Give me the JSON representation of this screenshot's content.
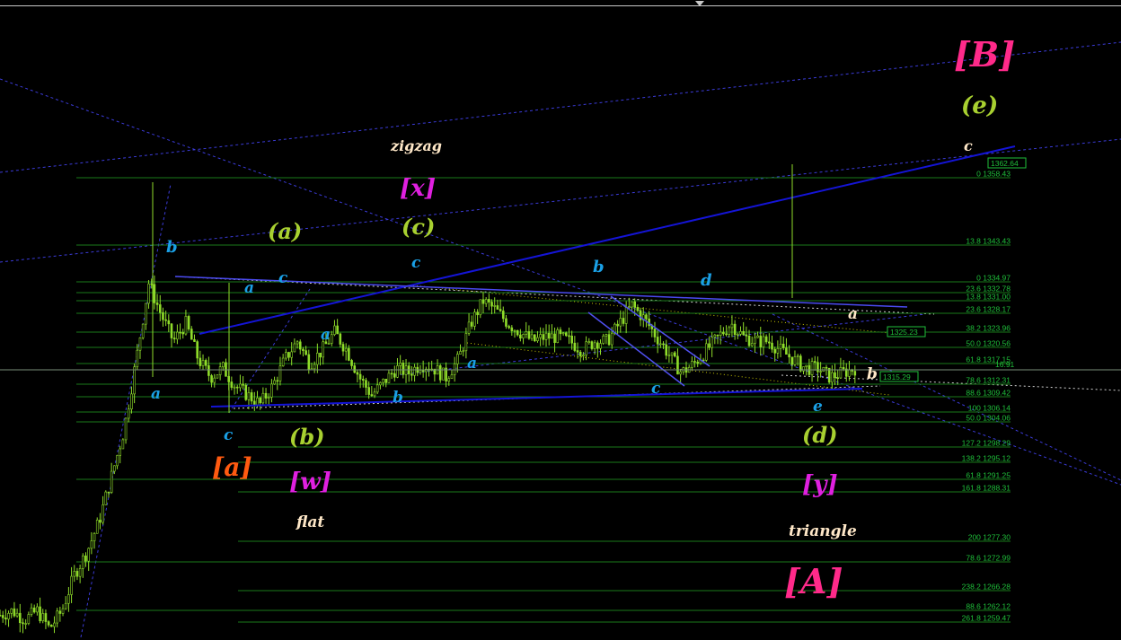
{
  "colors": {
    "background": "#000000",
    "fib_line": "#1a7a1a",
    "fib_text": "#1fbf3a",
    "candle": "#8fdc2a",
    "trend_blue": "#1414d6",
    "dash_blue": "#3b3bd8",
    "dash_white": "#d0d0d0",
    "dash_yellow": "#c8c800",
    "label_cyan": "#1aa0e6",
    "label_olive": "#a8d030",
    "label_magenta": "#e020e0",
    "label_pink": "#ff2a8a",
    "label_orange": "#ff5a10",
    "label_cream": "#ffe8c8",
    "price_box": "#1fbf3a"
  },
  "price_labels": {
    "box_upper": "1362.64",
    "box_mid": "1325.23",
    "box_current": "1315.29",
    "current_right": "16.91"
  },
  "fib_levels": [
    {
      "text": "0 1358.43"
    },
    {
      "text": "13.8 1343.43"
    },
    {
      "text": "0 1334.97"
    },
    {
      "text": "23.6 1332.78"
    },
    {
      "text": "13.8 1331.00"
    },
    {
      "text": "23.6 1328.17"
    },
    {
      "text": "38.2 1323.96"
    },
    {
      "text": "50.0 1320.56"
    },
    {
      "text": "61.8 1317.15"
    },
    {
      "text": "78.6 1312.31"
    },
    {
      "text": "88.6 1309.42"
    },
    {
      "text": "100 1306.14"
    },
    {
      "text": "50.0 1304.06"
    },
    {
      "text": "127.2 1298.29"
    },
    {
      "text": "138.2 1295.12"
    },
    {
      "text": "61.8 1291.25"
    },
    {
      "text": "161.8 1288.31"
    },
    {
      "text": "200 1277.30"
    },
    {
      "text": "78.6 1272.99"
    },
    {
      "text": "238.2 1266.28"
    },
    {
      "text": "88.6 1262.12"
    },
    {
      "text": "261.8 1259.47"
    }
  ],
  "wave_labels": {
    "big_B": "[B]",
    "e_paren": "(e)",
    "c_white_top": "c",
    "zigzag": "zigzag",
    "x_bracket": "[x]",
    "c_paren": "(c)",
    "a_paren": "(a)",
    "b_cyan_left": "b",
    "a_cyan_small": "a",
    "c_cyan_small": "c",
    "c_cyan_top": "c",
    "a_cyan_mid": "a",
    "b_cyan_top": "b",
    "d_cyan": "d",
    "a_white_right": "a",
    "a_cyan_lowleft": "a",
    "a_cyan_center": "a",
    "c_cyan_center": "c",
    "b_cyan_low": "b",
    "b_white_right": "b",
    "e_cyan": "e",
    "c_cyan_bottom": "c",
    "b_paren": "(b)",
    "d_paren": "(d)",
    "a_bracket": "[a]",
    "w_bracket": "[w]",
    "y_bracket": "[y]",
    "flat": "flat",
    "triangle": "triangle",
    "big_A": "[A]"
  },
  "chart_data": {
    "type": "candlestick",
    "instrument_hint": "",
    "price_axis_samples": [
      1358.43,
      1343.43,
      1334.97,
      1332.78,
      1331.0,
      1328.17,
      1323.96,
      1320.56,
      1317.15,
      1312.31,
      1309.42,
      1306.14,
      1304.06,
      1298.29,
      1295.12,
      1291.25,
      1288.31,
      1277.3,
      1272.99,
      1266.28,
      1262.12,
      1259.47
    ],
    "current_price": 1315.29,
    "marked_prices": [
      1362.64,
      1325.23,
      1315.29
    ],
    "close_path_prices": [
      1261,
      1262,
      1260,
      1262,
      1258,
      1262,
      1270,
      1275,
      1282,
      1292,
      1302,
      1318,
      1335,
      1328,
      1322,
      1326,
      1318,
      1314,
      1316,
      1312,
      1310,
      1308,
      1312,
      1318,
      1322,
      1317,
      1320,
      1324,
      1320,
      1314,
      1310,
      1313,
      1316,
      1315,
      1317,
      1316,
      1314,
      1318,
      1326,
      1331,
      1329,
      1326,
      1324,
      1322,
      1323,
      1323,
      1322,
      1320,
      1322,
      1322,
      1326,
      1330,
      1327,
      1323,
      1319,
      1315,
      1317,
      1320,
      1323,
      1326,
      1323,
      1322,
      1322,
      1320,
      1318,
      1316,
      1316,
      1314,
      1315,
      1316
    ],
    "grid": false
  }
}
